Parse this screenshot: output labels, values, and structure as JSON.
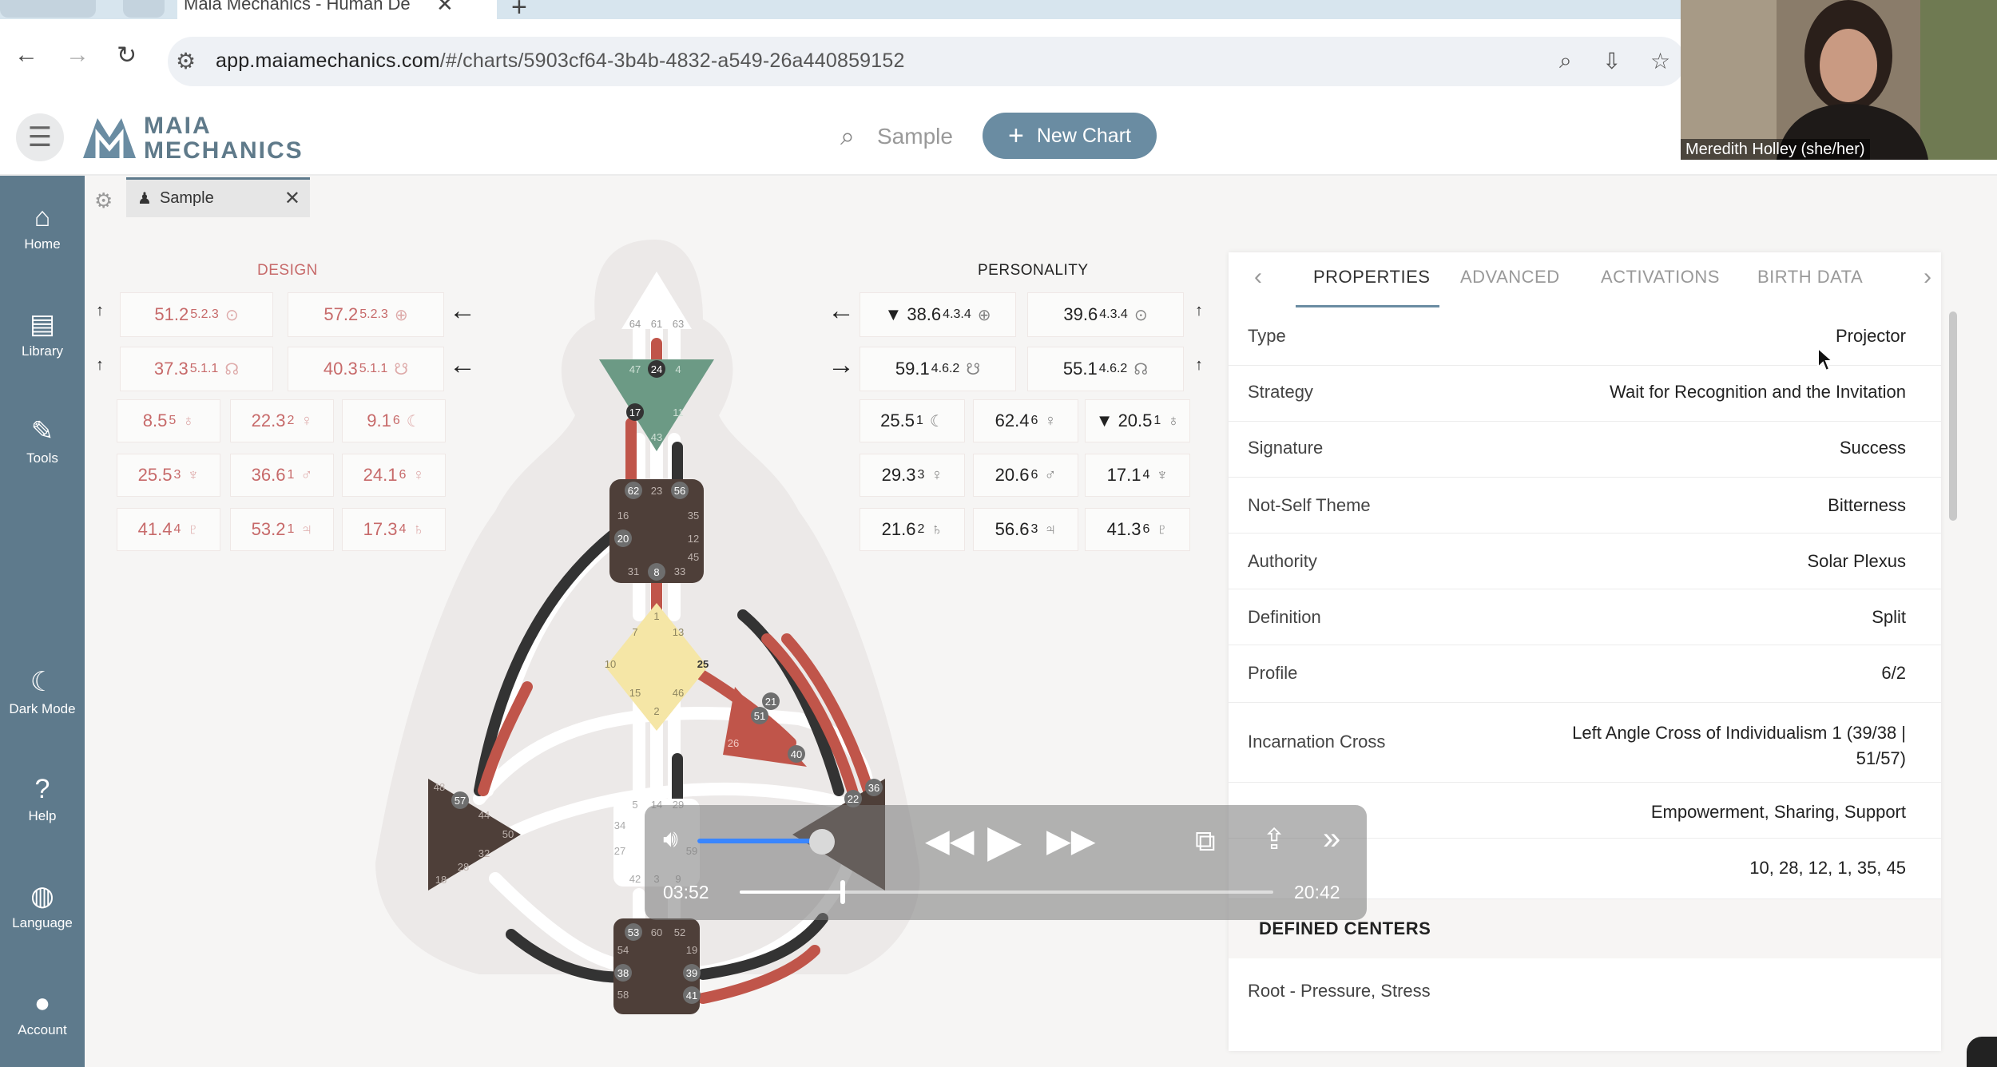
{
  "browser": {
    "tab_title": "Maia Mechanics - Human De",
    "url_host": "app.maiamechanics.com",
    "url_path": "/#/charts/5903cf64-3b4b-4832-a549-26a440859152"
  },
  "header": {
    "logo_line1": "MAIA",
    "logo_line2": "MECHANICS",
    "search_placeholder": "Sample",
    "new_chart_label": "New Chart"
  },
  "sidebar": {
    "items": [
      {
        "label": "Home",
        "icon": "home-icon"
      },
      {
        "label": "Library",
        "icon": "library-icon"
      },
      {
        "label": "Tools",
        "icon": "wrench-icon"
      },
      {
        "label": "Dark Mode",
        "icon": "moon-icon"
      },
      {
        "label": "Help",
        "icon": "help-icon"
      },
      {
        "label": "Language",
        "icon": "globe-icon"
      },
      {
        "label": "Account",
        "icon": "account-icon"
      }
    ]
  },
  "chart_tab": {
    "label": "Sample"
  },
  "design": {
    "title": "DESIGN",
    "row1": [
      {
        "gate": "51.2",
        "line": "5.2.3",
        "planet": "⊙"
      },
      {
        "gate": "57.2",
        "line": "5.2.3",
        "planet": "⊕"
      }
    ],
    "row2": [
      {
        "gate": "37.3",
        "line": "5.1.1",
        "planet": "☊"
      },
      {
        "gate": "40.3",
        "line": "5.1.1",
        "planet": "☋"
      }
    ],
    "grid": [
      {
        "gate": "8.5",
        "line": "5",
        "planet": "♁"
      },
      {
        "gate": "22.3",
        "line": "2",
        "planet": "♀"
      },
      {
        "gate": "9.1",
        "line": "6",
        "planet": "☾"
      },
      {
        "gate": "25.5",
        "line": "3",
        "planet": "♆"
      },
      {
        "gate": "36.6",
        "line": "1",
        "planet": "♂"
      },
      {
        "gate": "24.1",
        "line": "6",
        "planet": "♀"
      },
      {
        "gate": "41.4",
        "line": "4",
        "planet": "♇"
      },
      {
        "gate": "53.2",
        "line": "1",
        "planet": "♃"
      },
      {
        "gate": "17.3",
        "line": "4",
        "planet": "♄"
      }
    ]
  },
  "personality": {
    "title": "PERSONALITY",
    "row1": [
      {
        "gate": "▼ 38.6",
        "line": "4.3.4",
        "planet": "⊕"
      },
      {
        "gate": "39.6",
        "line": "4.3.4",
        "planet": "⊙"
      }
    ],
    "row2": [
      {
        "gate": "59.1",
        "line": "4.6.2",
        "planet": "☋"
      },
      {
        "gate": "55.1",
        "line": "4.6.2",
        "planet": "☊"
      }
    ],
    "grid": [
      {
        "gate": "25.5",
        "line": "1",
        "planet": "☾"
      },
      {
        "gate": "62.4",
        "line": "6",
        "planet": "♀"
      },
      {
        "gate": "▼ 20.5",
        "line": "1",
        "planet": "♁"
      },
      {
        "gate": "29.3",
        "line": "3",
        "planet": "♀"
      },
      {
        "gate": "20.6",
        "line": "6",
        "planet": "♂"
      },
      {
        "gate": "17.1",
        "line": "4",
        "planet": "♆"
      },
      {
        "gate": "21.6",
        "line": "2",
        "planet": "♄"
      },
      {
        "gate": "56.6",
        "line": "3",
        "planet": "♃"
      },
      {
        "gate": "41.3",
        "line": "6",
        "planet": "♇"
      }
    ]
  },
  "bodygraph": {
    "head_gates": [
      "64",
      "61",
      "63"
    ],
    "ajna_gates": [
      "47",
      "24",
      "4",
      "17",
      "11",
      "43"
    ],
    "throat_gates": [
      "62",
      "23",
      "56",
      "16",
      "35",
      "20",
      "12",
      "45",
      "31",
      "8",
      "33"
    ],
    "g_gates": [
      "1",
      "7",
      "13",
      "25",
      "10",
      "46",
      "15",
      "2"
    ],
    "heart_gates": [
      "21",
      "51",
      "26",
      "40"
    ],
    "spleen_gates": [
      "48",
      "57",
      "44",
      "50",
      "32",
      "28",
      "18"
    ],
    "sacral_gates": [
      "5",
      "14",
      "29",
      "34",
      "27",
      "42",
      "3",
      "9",
      "59"
    ],
    "solar_gates": [
      "36",
      "22"
    ],
    "root_gates": [
      "53",
      "60",
      "52",
      "54",
      "19",
      "38",
      "39",
      "58",
      "41"
    ]
  },
  "panel": {
    "tabs": [
      "PROPERTIES",
      "ADVANCED",
      "ACTIVATIONS",
      "BIRTH DATA"
    ],
    "rows": [
      {
        "key": "Type",
        "value": "Projector"
      },
      {
        "key": "Strategy",
        "value": "Wait for Recognition and the Invitation"
      },
      {
        "key": "Signature",
        "value": "Success"
      },
      {
        "key": "Not-Self Theme",
        "value": "Bitterness"
      },
      {
        "key": "Authority",
        "value": "Solar Plexus"
      },
      {
        "key": "Definition",
        "value": "Split"
      },
      {
        "key": "Profile",
        "value": "6/2"
      },
      {
        "key": "Incarnation Cross",
        "value": "Left Angle Cross of Individualism 1 (39/38 | 51/57)"
      },
      {
        "key": "",
        "value": "Empowerment, Sharing, Support"
      },
      {
        "key": "",
        "value": "10, 28, 12, 1, 35, 45"
      }
    ],
    "section_title": "DEFINED CENTERS",
    "section_first": "Root - Pressure, Stress"
  },
  "video": {
    "participant": "Meredith Holley (she/her)"
  },
  "player": {
    "current_time": "03:52",
    "total_time": "20:42",
    "progress": 0.19,
    "volume": 0.94
  }
}
